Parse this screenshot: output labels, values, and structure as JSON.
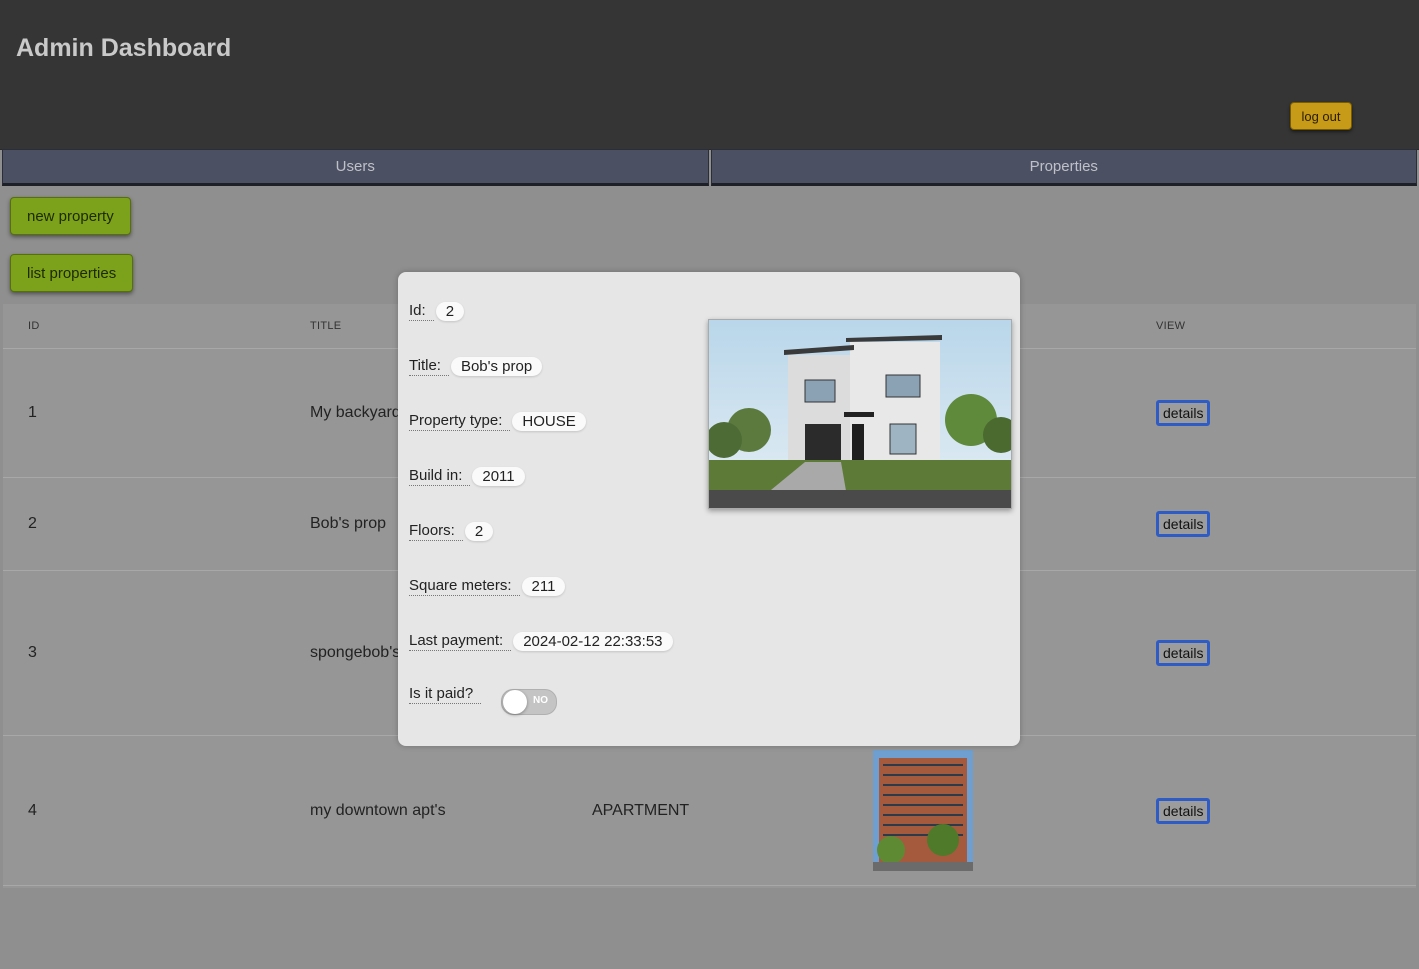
{
  "header": {
    "title": "Admin Dashboard",
    "logout_label": "log out"
  },
  "tabs": [
    {
      "label": "Users"
    },
    {
      "label": "Properties"
    }
  ],
  "actions": {
    "new_property": "new property",
    "list_properties": "list properties"
  },
  "table": {
    "columns": {
      "id": "ID",
      "title": "TITLE",
      "view": "VIEW"
    },
    "rows": [
      {
        "id": "1",
        "title": "My backyard",
        "type": "",
        "details": "details"
      },
      {
        "id": "2",
        "title": "Bob's prop",
        "type": "",
        "details": "details"
      },
      {
        "id": "3",
        "title": "spongebob's",
        "type": "",
        "details": "details"
      },
      {
        "id": "4",
        "title": "my downtown apt's",
        "type": "APARTMENT",
        "details": "details"
      }
    ]
  },
  "modal": {
    "id_label": "Id:",
    "id": "2",
    "title_label": "Title:",
    "title": "Bob's prop",
    "type_label": "Property type:",
    "type": "HOUSE",
    "build_label": "Build in:",
    "build": "2011",
    "floors_label": "Floors:",
    "floors": "2",
    "sqm_label": "Square meters:",
    "sqm": "211",
    "payment_label": "Last payment:",
    "payment": "2024-02-12 22:33:53",
    "paid_label": "Is it paid?",
    "paid_toggle": "NO"
  }
}
